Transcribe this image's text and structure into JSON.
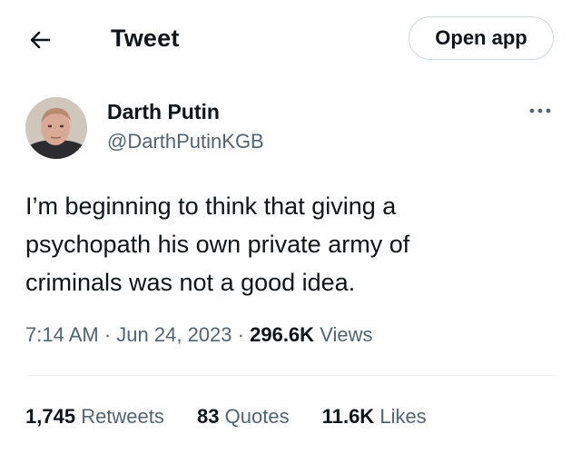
{
  "header": {
    "back_icon": "arrow-left-icon",
    "title": "Tweet",
    "open_app_label": "Open app"
  },
  "author": {
    "name": "Darth Putin",
    "handle": "@DarthPutinKGB",
    "more_icon": "more-horizontal-icon"
  },
  "tweet": {
    "lines": [
      "I’m beginning to think that giving a",
      "psychopath his own private army of",
      "criminals was not a good idea."
    ]
  },
  "meta": {
    "time": "7:14 AM",
    "separator": "·",
    "date": "Jun 24, 2023",
    "views_count": "296.6K",
    "views_label": "Views"
  },
  "stats": {
    "retweets_count": "1,745",
    "retweets_label": "Retweets",
    "quotes_count": "83",
    "quotes_label": "Quotes",
    "likes_count": "11.6K",
    "likes_label": "Likes"
  },
  "colors": {
    "text": "#0f1419",
    "secondary": "#536471",
    "border": "#cfd9de",
    "divider": "#eff3f4"
  }
}
